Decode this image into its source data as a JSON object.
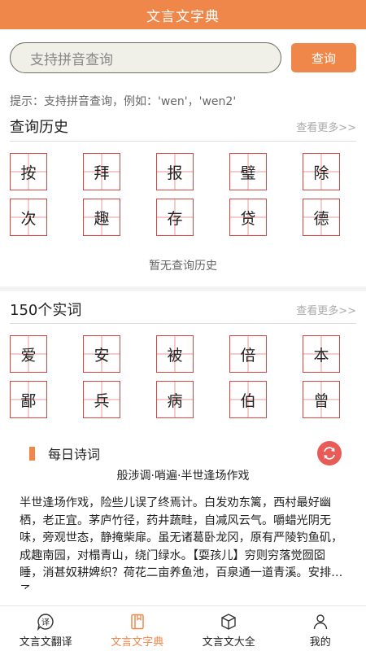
{
  "header": {
    "title": "文言文字典"
  },
  "search": {
    "placeholder": "支持拼音查询",
    "button_label": "查询"
  },
  "hint": "提示：支持拼音查询，例如：'wen'，'wen2'",
  "history": {
    "title": "查询历史",
    "more": "查看更多>>",
    "chars": [
      "按",
      "拜",
      "报",
      "璧",
      "除",
      "次",
      "趣",
      "存",
      "贷",
      "德"
    ],
    "empty_text": "暂无查询历史"
  },
  "words": {
    "title": "150个实词",
    "more": "查看更多>>",
    "chars": [
      "爱",
      "安",
      "被",
      "倍",
      "本",
      "鄙",
      "兵",
      "病",
      "伯",
      "曾"
    ]
  },
  "daily_poem": {
    "title": "每日诗词",
    "poem_title": "般涉调·哨遍·半世逢场作戏",
    "body": "半世逢场作戏，险些儿误了终焉计。白发劝东篱，西村最好幽栖，老正宜。茅庐竹径，药井蔬畦，自减风云气。嚼蜡光阴无味，旁观世态，静掩柴扉。虽无诸葛卧龙冈，原有严陵钓鱼矶，成趣南园，对榻青山，绕门绿水。【耍孩儿】穷则穷落觉囫囵睡，消甚奴耕婢织？荷花二亩养鱼池，百泉通一道青溪。安排老子…"
  },
  "tabs": [
    {
      "label": "文言文翻译",
      "icon": "translate-icon",
      "active": false
    },
    {
      "label": "文言文字典",
      "icon": "book-icon",
      "active": true
    },
    {
      "label": "文言文大全",
      "icon": "box-icon",
      "active": false
    },
    {
      "label": "我的",
      "icon": "user-icon",
      "active": false
    }
  ],
  "colors": {
    "accent": "#f0874a",
    "grid_red": "#d64540",
    "refresh_red": "#e85b57"
  }
}
